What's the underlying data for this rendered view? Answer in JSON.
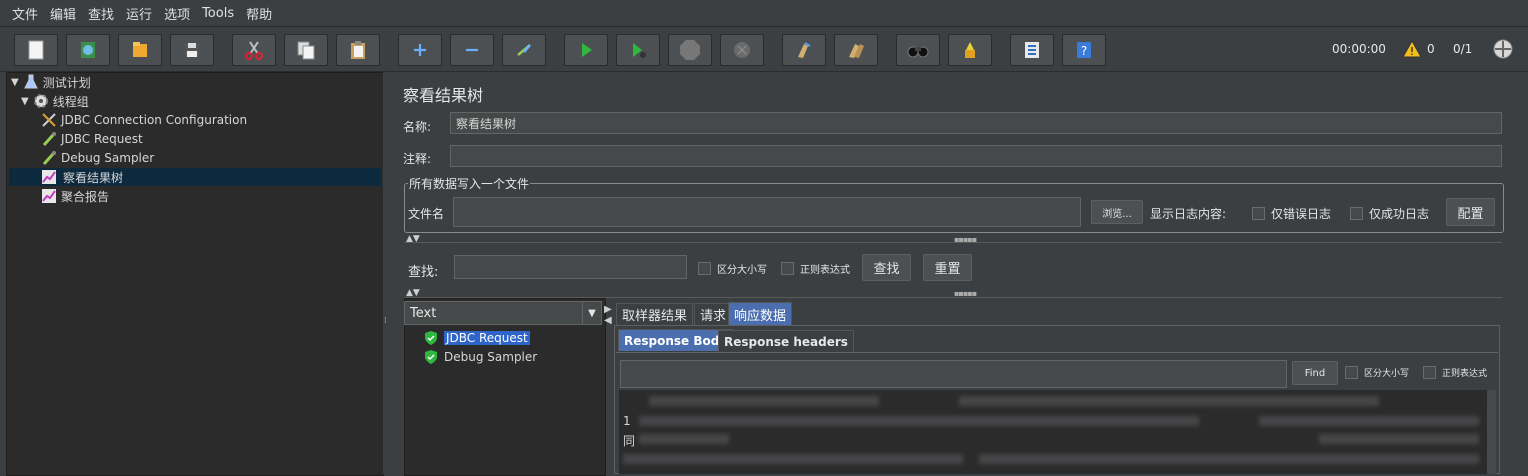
{
  "menubar": [
    "文件",
    "编辑",
    "查找",
    "运行",
    "选项",
    "Tools",
    "帮助"
  ],
  "toolbar": {
    "buttons": [
      "new-icon",
      "templates-icon",
      "open-icon",
      "save-icon",
      "cut-icon",
      "copy-icon",
      "paste-icon",
      "expand-icon",
      "collapse-icon",
      "toggle-icon",
      "start-icon",
      "start-no-pause-icon",
      "stop-icon",
      "shutdown-icon",
      "clear-icon",
      "clear-all-icon",
      "search-icon",
      "reset-search-icon",
      "function-helper-icon",
      "help-icon"
    ],
    "timer": "00:00:00",
    "warnings": "0",
    "threads": "0/1"
  },
  "tree": {
    "root": "测试计划",
    "thread_group": "线程组",
    "children": [
      "JDBC Connection Configuration",
      "JDBC Request",
      "Debug Sampler",
      "察看结果树",
      "聚合报告"
    ],
    "selected": "察看结果树"
  },
  "main": {
    "title": "察看结果树",
    "name_label": "名称:",
    "name_value": "察看结果树",
    "comment_label": "注释:",
    "comment_value": "",
    "file_group_title": "所有数据写入一个文件",
    "filename_label": "文件名",
    "filename_value": "",
    "browse_button": "浏览...",
    "log_label": "显示日志内容:",
    "errors_only": "仅错误日志",
    "success_only": "仅成功日志",
    "configure_button": "配置",
    "search_label": "查找:",
    "search_value": "",
    "case_sensitive": "区分大小写",
    "regex": "正则表达式",
    "find_button": "查找",
    "reset_button": "重置"
  },
  "results": {
    "renderer": "Text",
    "items": [
      "JDBC Request",
      "Debug Sampler"
    ],
    "selected": "JDBC Request",
    "tabs": [
      "取样器结果",
      "请求",
      "响应数据"
    ],
    "active_tab": "响应数据",
    "subtabs": [
      "Response Body",
      "Response headers"
    ],
    "active_subtab": "Response Body",
    "find_button": "Find",
    "case_sensitive": "区分大小写",
    "regex": "正则表达式",
    "body_visible_chars": [
      "1",
      "同"
    ]
  }
}
